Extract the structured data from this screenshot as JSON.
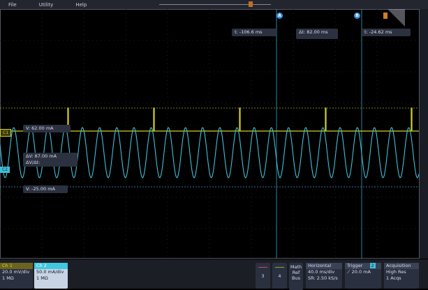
{
  "menu": [
    "File",
    "Utility",
    "Help"
  ],
  "cursors": {
    "a_label": "A",
    "b_label": "B",
    "a_time": "t:   -106.6 ms",
    "delta_time": "Δt: 82.00 ms",
    "b_time": "t:   -24.62 ms"
  },
  "readouts": {
    "v1": "V:   62.00 mA",
    "dv": "ΔV:        87.00 mA",
    "dvdt": "ΔV/Δt:",
    "v2": "V:   -25.00 mA"
  },
  "channels": {
    "c1_marker": "C1",
    "c2_marker": "C2"
  },
  "bottom": {
    "ch1": {
      "title": "Ch 1",
      "scale": "20.0 mV/div",
      "imp": "1 MΩ"
    },
    "ch2": {
      "title": "Ch 2",
      "scale": "50.0 mA/div",
      "imp": "1 MΩ"
    },
    "ch3": "3",
    "ch4": "4",
    "math": [
      "Math",
      "Ref",
      "Bus"
    ],
    "horizontal": {
      "title": "Horizontal",
      "scale": "40.0 ms/div",
      "sr": "SR: 2.50 kS/s"
    },
    "trigger": {
      "title": "Trigger",
      "src": "2",
      "level": "20.0 mA"
    },
    "acquisition": {
      "title": "Acquisition",
      "mode": "High Res",
      "acqs": "1 Acqs"
    }
  },
  "colors": {
    "ch1": "#d8d020",
    "ch2": "#40c0d8",
    "cursor": "#3a8ee0",
    "trigger": "#d08020"
  }
}
